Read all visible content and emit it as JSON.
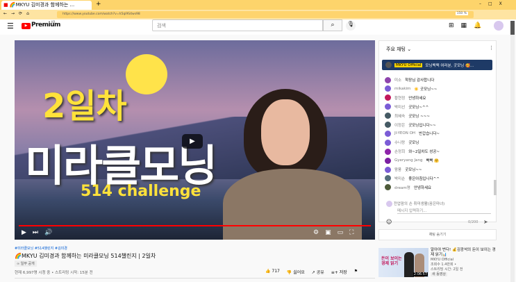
{
  "browser": {
    "tab_title": "🌈MKYU 김미경과 함께하는 ...",
    "url": "https://www.youtube.com/watch?v=h5qi9S4ws98",
    "zoom": "150 %"
  },
  "header": {
    "logo": "Premium",
    "logo_badge": "KR",
    "search_placeholder": "검색"
  },
  "video": {
    "line1": "2일차",
    "line2": "미라클모닝",
    "line3": "514 challenge",
    "progress": 1.0
  },
  "chat": {
    "title": "주요 채팅",
    "pinned": {
      "author": "MKYU Official",
      "text": "모닝백팩 여러분, 굿모닝 🥰..."
    },
    "messages": [
      {
        "author": "미소",
        "text": "학장님 감사합니다",
        "color": "#8e44ad"
      },
      {
        "author": "mikakim",
        "text": "☀️ 굿모닝~~",
        "color": "#7b5cd6"
      },
      {
        "author": "황현정",
        "text": "안녕하세요",
        "color": "#c2185b"
      },
      {
        "author": "박미선",
        "text": "굿모닝~^^",
        "color": "#7b5cd6"
      },
      {
        "author": "최혜숙",
        "text": "굿모닝 ~~~",
        "color": "#455a64"
      },
      {
        "author": "이정은",
        "text": "굿모닝입니다~~",
        "color": "#455a64"
      },
      {
        "author": "JI-YEON OH",
        "text": "반갑습니다~",
        "color": "#7b5cd6"
      },
      {
        "author": "수니랑",
        "text": "굿모닝",
        "color": "#7b5cd6"
      },
      {
        "author": "손정희",
        "text": "와~2일차도 성공~",
        "color": "#8e24aa"
      },
      {
        "author": "Gyeryang Jang",
        "text": "빡빡 🤗",
        "color": "#7b1fa2"
      },
      {
        "author": "왕풍",
        "text": "굿모닝~~",
        "color": "#7b5cd6"
      },
      {
        "author": "박미순",
        "text": "좋은아침입니다^^",
        "color": "#546e7a"
      },
      {
        "author": "dream명",
        "text": "안녕하세요",
        "color": "#4e5b3a"
      }
    ],
    "input_user": "전업맘의 손 취미생활(꿈은마녀)",
    "input_placeholder": "메시지 입력하기...",
    "counter": "0/200",
    "hide_chat": "채팅 숨기기"
  },
  "info": {
    "hashtags": "#미라클모닝 #514챌린지 #김미경",
    "title": "🌈MKYU 김미경과 함께하는 미라클모닝 514챌린지 | 2일차",
    "visibility": "일부 공개",
    "stats": "현재 6,997명 시청 중 • 스트리밍 시작: 15분 전",
    "likes": "717",
    "dislike": "싫어요",
    "share": "공유",
    "save": "저장"
  },
  "related": {
    "title": "알아야 번다! 💰김광석의 돈이 보이는 경제 읽기📊",
    "channel": "MKYU Official",
    "views": "조회수 1.4만회 •",
    "time": "스트리밍 시간: 2일 전",
    "badge": "새 동영상",
    "duration": "2:06:57",
    "thumb_text": "돈이 보이는 경제 읽기"
  }
}
